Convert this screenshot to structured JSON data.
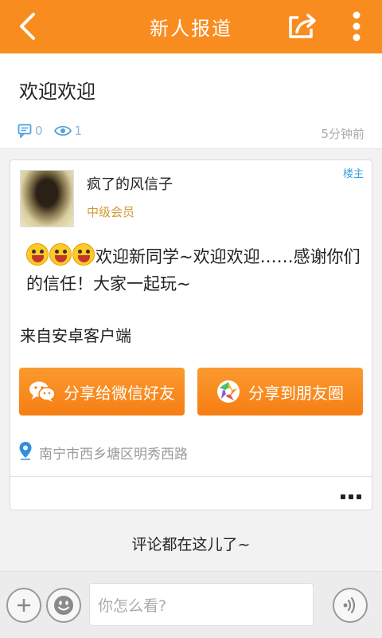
{
  "header": {
    "title": "新人报道",
    "back_icon": "back-arrow-icon",
    "share_icon": "share-icon",
    "more_icon": "more-vertical-icon",
    "bg_color": "#f98c1f"
  },
  "summary": {
    "post_title": "欢迎欢迎",
    "comment_count": "0",
    "view_count": "1",
    "time_ago": "5分钟前"
  },
  "post": {
    "username": "疯了的风信子",
    "member_level": "中级会员",
    "owner_tag": "楼主",
    "content_text": "欢迎新同学~欢迎欢迎……感谢你们的信任！大家一起玩~",
    "emoji_count": 3,
    "from_text": "来自安卓客户端",
    "share_wechat_label": "分享给微信好友",
    "share_moments_label": "分享到朋友圈",
    "location": "南宁市西乡塘区明秀西路"
  },
  "comments_hint": "评论都在这儿了~",
  "bottombar": {
    "input_placeholder": "你怎么看?"
  }
}
